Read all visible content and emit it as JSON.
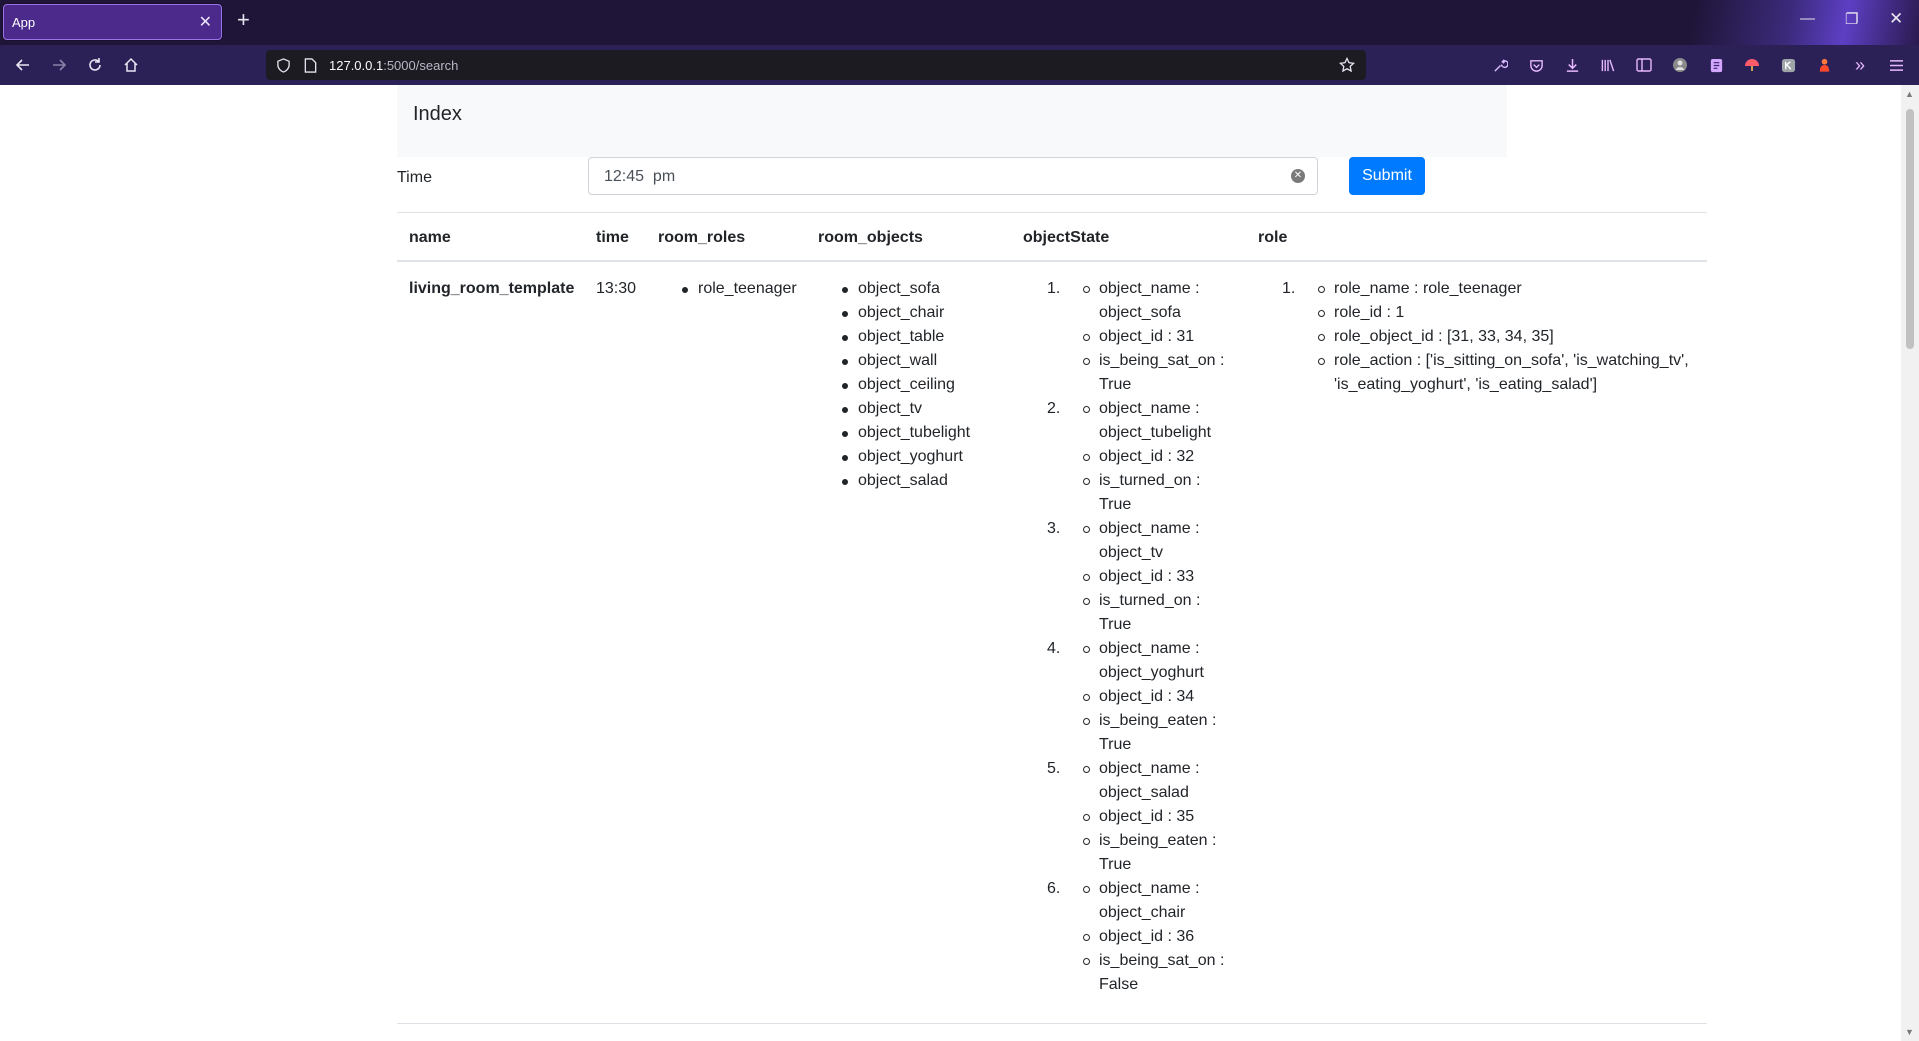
{
  "browser": {
    "tab_title": "App",
    "url_host": "127.0.0.1",
    "url_path": ":5000/search"
  },
  "page": {
    "heading": "Index",
    "form": {
      "time_label": "Time",
      "time_value": "12:45  pm",
      "submit_label": "Submit"
    },
    "table": {
      "headers": [
        "name",
        "time",
        "room_roles",
        "room_objects",
        "objectState",
        "role"
      ],
      "row": {
        "name": "living_room_template",
        "time": "13:30",
        "room_roles": [
          "role_teenager"
        ],
        "room_objects": [
          "object_sofa",
          "object_chair",
          "object_table",
          "object_wall",
          "object_ceiling",
          "object_tv",
          "object_tubelight",
          "object_yoghurt",
          "object_salad"
        ],
        "object_state": [
          {
            "num": "1.",
            "lines": [
              "object_name : object_sofa",
              "object_id : 31",
              "is_being_sat_on : True"
            ]
          },
          {
            "num": "2.",
            "lines": [
              "object_name : object_tubelight",
              "object_id : 32",
              "is_turned_on : True"
            ]
          },
          {
            "num": "3.",
            "lines": [
              "object_name : object_tv",
              "object_id : 33",
              "is_turned_on : True"
            ]
          },
          {
            "num": "4.",
            "lines": [
              "object_name : object_yoghurt",
              "object_id : 34",
              "is_being_eaten : True"
            ]
          },
          {
            "num": "5.",
            "lines": [
              "object_name : object_salad",
              "object_id : 35",
              "is_being_eaten : True"
            ]
          },
          {
            "num": "6.",
            "lines": [
              "object_name : object_chair",
              "object_id : 36",
              "is_being_sat_on : False"
            ]
          }
        ],
        "role": [
          {
            "num": "1.",
            "lines": [
              "role_name : role_teenager",
              "role_id : 1",
              "role_object_id : [31, 33, 34, 35]",
              "role_action : ['is_sitting_on_sofa', 'is_watching_tv', 'is_eating_yoghurt', 'is_eating_salad']"
            ]
          }
        ]
      }
    }
  },
  "colors": {
    "accent": "#007bff",
    "tabbar": "#1f1538",
    "navbar": "#2b2157"
  },
  "icons": [
    "back-icon",
    "forward-icon",
    "reload-icon",
    "home-icon",
    "shield-icon",
    "page-icon",
    "bookmark-star-icon",
    "wrench-icon",
    "pocket-icon",
    "download-icon",
    "library-icon",
    "sidebar-icon",
    "account-icon",
    "extension-icon",
    "overflow-icon",
    "menu-icon"
  ]
}
